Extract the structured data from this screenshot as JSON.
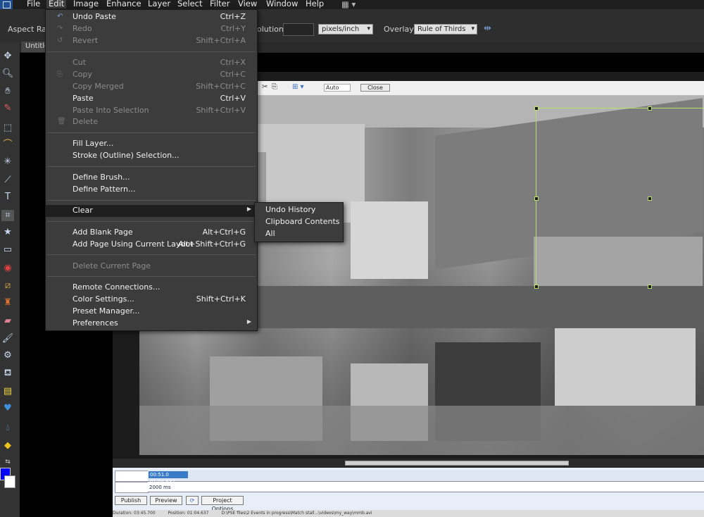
{
  "menubar": {
    "items": [
      "File",
      "Edit",
      "Image",
      "Enhance",
      "Layer",
      "Select",
      "Filter",
      "View",
      "Window",
      "Help"
    ]
  },
  "options_bar": {
    "aspect_ratio_label": "Aspect Rati",
    "resolution_label": "olution:",
    "resolution_unit": "pixels/inch",
    "overlay_label": "Overlay:",
    "overlay_value": "Rule of Thirds"
  },
  "document_tab": {
    "label": "Untitle"
  },
  "viewer_toolbar": {
    "zoom": "Auto",
    "close_label": "Close"
  },
  "edit_menu": {
    "items": [
      {
        "label": "Undo Paste",
        "shortcut": "Ctrl+Z",
        "enabled": true
      },
      {
        "label": "Redo",
        "shortcut": "Ctrl+Y",
        "enabled": false
      },
      {
        "label": "Revert",
        "shortcut": "Shift+Ctrl+A",
        "enabled": false
      },
      {
        "label": "Cut",
        "shortcut": "Ctrl+X",
        "enabled": false
      },
      {
        "label": "Copy",
        "shortcut": "Ctrl+C",
        "enabled": false
      },
      {
        "label": "Copy Merged",
        "shortcut": "Shift+Ctrl+C",
        "enabled": false
      },
      {
        "label": "Paste",
        "shortcut": "Ctrl+V",
        "enabled": true
      },
      {
        "label": "Paste Into Selection",
        "shortcut": "Shift+Ctrl+V",
        "enabled": false
      },
      {
        "label": "Delete",
        "shortcut": "",
        "enabled": false
      },
      {
        "label": "Fill Layer...",
        "shortcut": "",
        "enabled": true
      },
      {
        "label": "Stroke (Outline) Selection...",
        "shortcut": "",
        "enabled": true
      },
      {
        "label": "Define Brush...",
        "shortcut": "",
        "enabled": true
      },
      {
        "label": "Define Pattern...",
        "shortcut": "",
        "enabled": true
      },
      {
        "label": "Clear",
        "shortcut": "",
        "enabled": true
      },
      {
        "label": "Add Blank Page",
        "shortcut": "Alt+Ctrl+G",
        "enabled": true
      },
      {
        "label": "Add Page Using Current Layout",
        "shortcut": "Alt+Shift+Ctrl+G",
        "enabled": true
      },
      {
        "label": "Delete Current Page",
        "shortcut": "",
        "enabled": false
      },
      {
        "label": "Remote Connections...",
        "shortcut": "",
        "enabled": true
      },
      {
        "label": "Color Settings...",
        "shortcut": "Shift+Ctrl+K",
        "enabled": true
      },
      {
        "label": "Preset Manager...",
        "shortcut": "",
        "enabled": true
      },
      {
        "label": "Preferences",
        "shortcut": "",
        "enabled": true
      }
    ]
  },
  "clear_submenu": {
    "items": [
      "Undo History",
      "Clipboard Contents",
      "All"
    ]
  },
  "timeline": {
    "time_value": "00:51.0 01:04.637",
    "duration_ms": "2000 ms",
    "publish_label": "Publish",
    "preview_label": "Preview",
    "project_options_label": "Project Options"
  },
  "status_bar": {
    "duration": "Duration: 03:45.700",
    "position": "Position: 01:04.637",
    "path": "D:\\PSE files\\2 Events in progress\\Match stall...\\videos\\my_way\\mmb.avi"
  },
  "colors": {
    "foreground": "#0000ff",
    "background": "#ffffff",
    "crop_border": "#b8e06a"
  }
}
